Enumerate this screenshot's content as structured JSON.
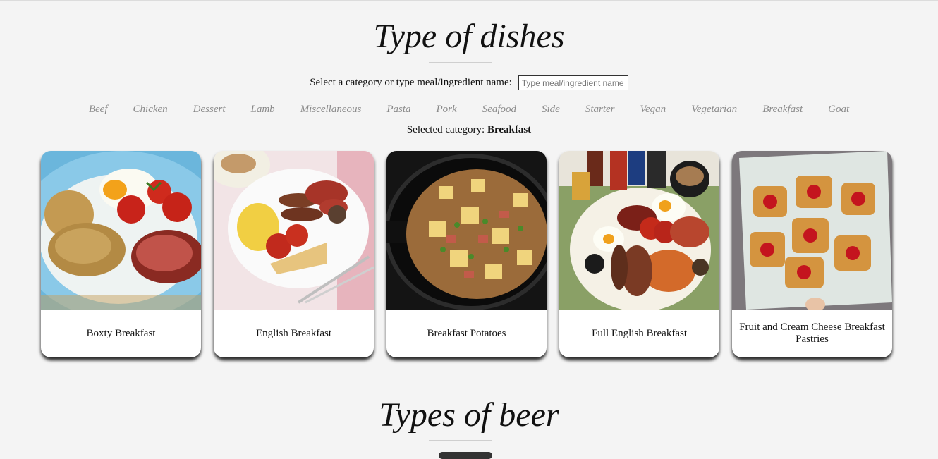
{
  "dishes": {
    "title": "Type of dishes",
    "search_label": "Select a category or type meal/ingredient name:",
    "search_placeholder": "Type meal/ingredient name",
    "categories": [
      "Beef",
      "Chicken",
      "Dessert",
      "Lamb",
      "Miscellaneous",
      "Pasta",
      "Pork",
      "Seafood",
      "Side",
      "Starter",
      "Vegan",
      "Vegetarian",
      "Breakfast",
      "Goat"
    ],
    "selected_label": "Selected category:",
    "selected_value": "Breakfast",
    "meals": [
      {
        "name": "Boxty Breakfast"
      },
      {
        "name": "English Breakfast"
      },
      {
        "name": "Breakfast Potatoes"
      },
      {
        "name": "Full English Breakfast"
      },
      {
        "name": "Fruit and Cream Cheese Breakfast Pastries"
      }
    ]
  },
  "beer": {
    "title": "Types of beer"
  }
}
